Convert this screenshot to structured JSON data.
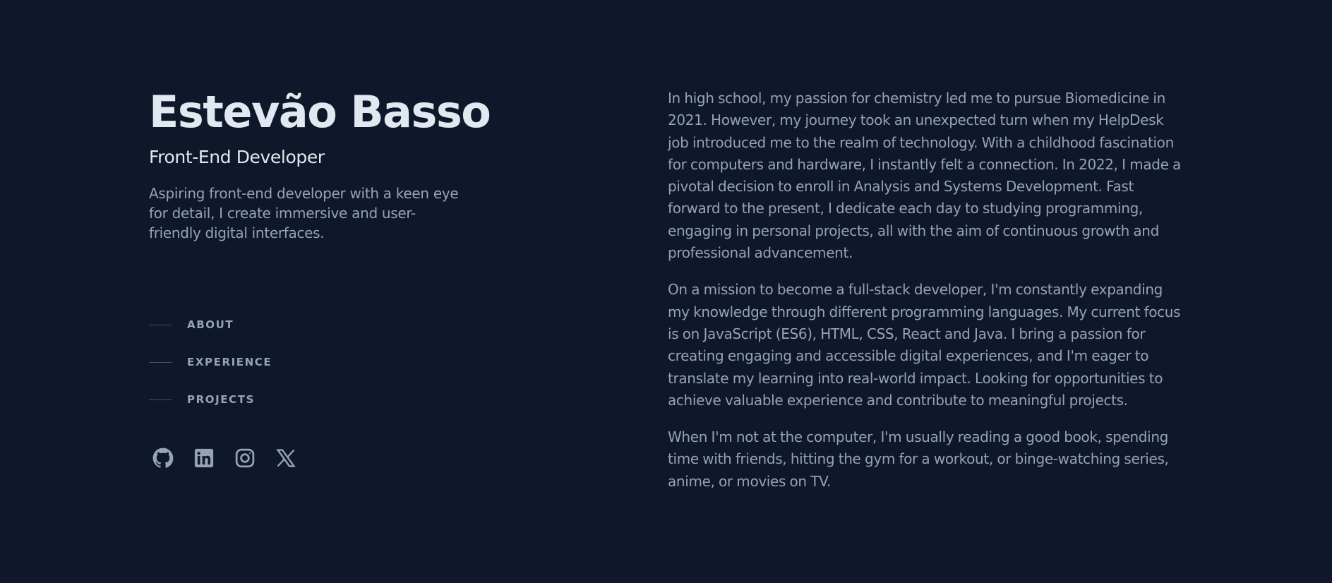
{
  "header": {
    "name": "Estevão Basso",
    "role": "Front-End Developer",
    "tagline": "Aspiring front-end developer with a keen eye for detail, I create immersive and user-friendly digital interfaces."
  },
  "nav": {
    "items": [
      {
        "label": "ABOUT"
      },
      {
        "label": "EXPERIENCE"
      },
      {
        "label": "PROJECTS"
      }
    ]
  },
  "social": {
    "icons": [
      "github-icon",
      "linkedin-icon",
      "instagram-icon",
      "x-icon"
    ]
  },
  "about": {
    "paragraphs": [
      "In high school, my passion for chemistry led me to pursue Biomedicine in 2021. However, my journey took an unexpected turn when my HelpDesk job introduced me to the realm of technology. With a childhood fascination for computers and hardware, I instantly felt a connection. In 2022, I made a pivotal decision to enroll in Analysis and Systems Development. Fast forward to the present, I dedicate each day to studying programming, engaging in personal projects, all with the aim of continuous growth and professional advancement.",
      "On a mission to become a full-stack developer, I'm constantly expanding my knowledge through different programming languages. My current focus is on JavaScript (ES6), HTML, CSS, React and Java. I bring a passion for creating engaging and accessible digital experiences, and I'm eager to translate my learning into real-world impact. Looking for opportunities to achieve valuable experience and contribute to meaningful projects.",
      "When I'm not at the computer, I'm usually reading a good book, spending time with friends, hitting the gym for a workout, or binge-watching series, anime, or movies on TV."
    ]
  },
  "colors": {
    "background": "#0f172a",
    "heading": "#e2e8f0",
    "body_text": "#94a3b8",
    "nav_line": "#475569"
  }
}
